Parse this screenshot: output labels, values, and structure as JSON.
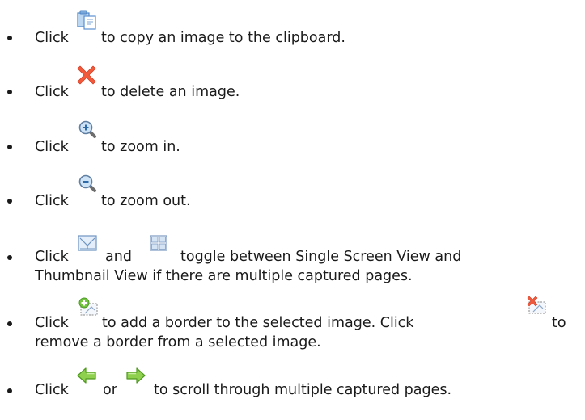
{
  "items": [
    {
      "pre": "Click",
      "post": "to copy an image to the clipboard.",
      "icons": [
        "copy-icon"
      ]
    },
    {
      "pre": "Click",
      "post": "to delete an image.",
      "icons": [
        "delete-icon"
      ]
    },
    {
      "pre": "Click",
      "post": "to zoom in.",
      "icons": [
        "zoom-in-icon"
      ]
    },
    {
      "pre": "Click",
      "post": "to zoom out.",
      "icons": [
        "zoom-out-icon"
      ]
    },
    {
      "pre": "Click",
      "mid": "and",
      "post": "toggle between Single Screen View and",
      "line2": "Thumbnail View if there are multiple captured pages.",
      "icons": [
        "single-screen-view-icon",
        "thumbnail-view-icon"
      ]
    },
    {
      "pre": "Click",
      "post": "to add a border to the selected image. Click",
      "end": "to",
      "line2": "remove a border from a selected image.",
      "icons": [
        "add-border-icon",
        "remove-border-icon"
      ]
    },
    {
      "pre": "Click",
      "mid": "or",
      "post": "to scroll through multiple captured pages.",
      "icons": [
        "back-arrow-icon",
        "forward-arrow-icon"
      ]
    }
  ]
}
